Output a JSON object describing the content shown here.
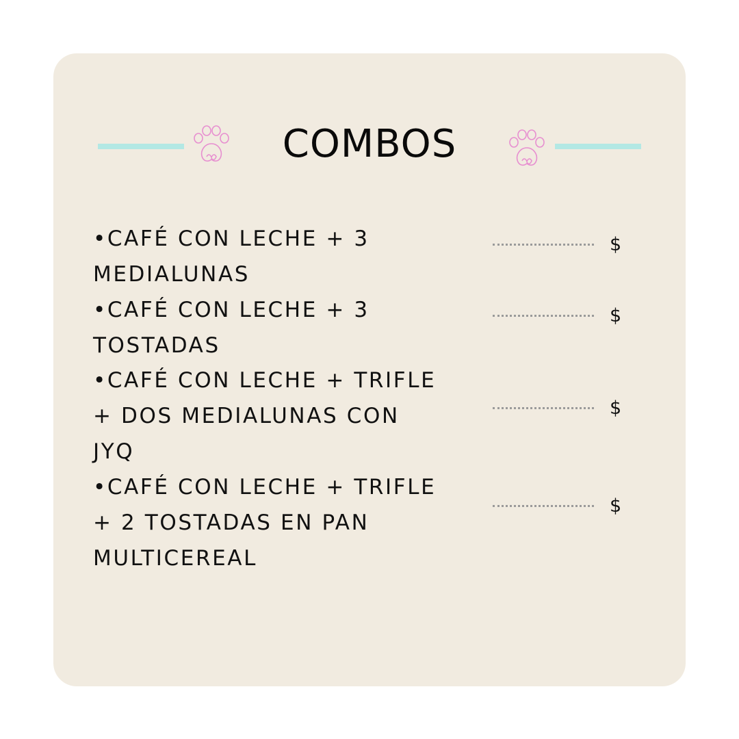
{
  "title": "COMBOS",
  "items": [
    {
      "text": "•CAFÉ CON LECHE + 3 MEDIALUNAS",
      "price": "$"
    },
    {
      "text": "•CAFÉ CON LECHE + 3 TOSTADAS",
      "price": "$"
    },
    {
      "text": "•CAFÉ CON LECHE + TRIFLE + DOS MEDIALUNAS CON JYQ",
      "price": "$"
    },
    {
      "text": "•CAFÉ CON LECHE + TRIFLE + 2 TOSTADAS EN PAN MULTICEREAL",
      "price": "$"
    }
  ],
  "colors": {
    "card_background": "#f1ebe0",
    "accent_line": "#b3e8e4",
    "paw": "#e78fd0",
    "text": "#111111"
  },
  "icons": [
    "paw-icon"
  ]
}
